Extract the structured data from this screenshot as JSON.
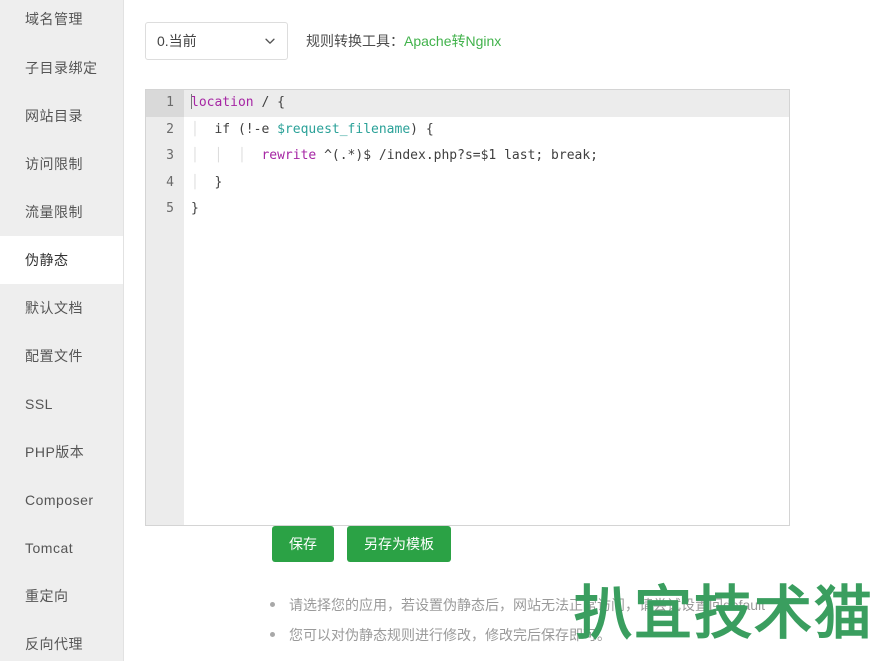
{
  "sidebar": {
    "items": [
      {
        "label": "域名管理",
        "active": false
      },
      {
        "label": "子目录绑定",
        "active": false
      },
      {
        "label": "网站目录",
        "active": false
      },
      {
        "label": "访问限制",
        "active": false
      },
      {
        "label": "流量限制",
        "active": false
      },
      {
        "label": "伪静态",
        "active": true
      },
      {
        "label": "默认文档",
        "active": false
      },
      {
        "label": "配置文件",
        "active": false
      },
      {
        "label": "SSL",
        "active": false
      },
      {
        "label": "PHP版本",
        "active": false
      },
      {
        "label": "Composer",
        "active": false
      },
      {
        "label": "Tomcat",
        "active": false
      },
      {
        "label": "重定向",
        "active": false
      },
      {
        "label": "反向代理",
        "active": false
      }
    ]
  },
  "toolbar": {
    "select": {
      "value": "0.当前",
      "options": [
        "0.当前"
      ],
      "caret_icon": "chevron-down-icon"
    },
    "tool_label": "规则转换工具：",
    "tool_link": "Apache转Nginx"
  },
  "editor": {
    "lines": [
      {
        "no": "1",
        "active": true
      },
      {
        "no": "2",
        "active": false
      },
      {
        "no": "3",
        "active": false
      },
      {
        "no": "4",
        "active": false
      },
      {
        "no": "5",
        "active": false
      }
    ],
    "code": {
      "l1_kw": "location",
      "l1_rest": " / {",
      "l2_if": "if (!-e ",
      "l2_var": "$request_filename",
      "l2_rest": ") {",
      "l3_kw": "rewrite",
      "l3_rest": " ^(.*)$ /index.php?s=$1 last; break;",
      "l4": "}",
      "l5": "}"
    }
  },
  "buttons": {
    "save": "保存",
    "save_as_template": "另存为模板"
  },
  "hints": [
    "请选择您的应用，若设置伪静态后，网站无法正常访问，请尝试设置回default",
    "您可以对伪静态规则进行修改，修改完后保存即可。"
  ],
  "watermark": {
    "text": "扒宜技术猫"
  },
  "colors": {
    "accent_green": "#2ba245",
    "link_green": "#41b24b",
    "sidebar_bg": "#eeeeee",
    "keyword_purple": "#a626a4",
    "variable_teal": "#2aa198",
    "watermark_green": "#3a9e5f"
  }
}
